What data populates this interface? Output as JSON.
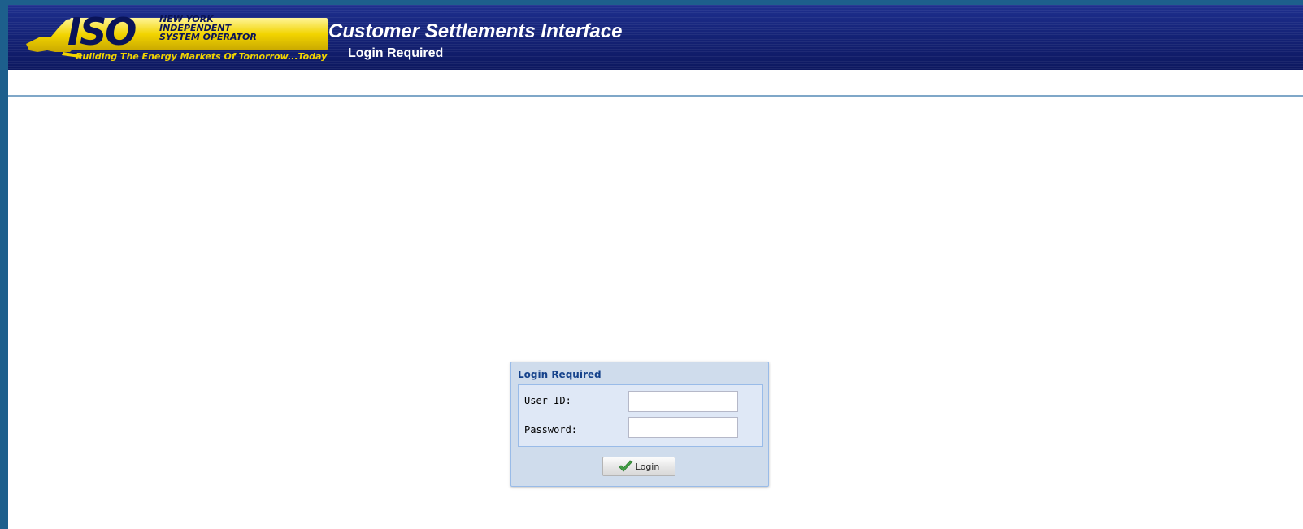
{
  "header": {
    "logo": {
      "mark": "ISO",
      "org_lines": [
        "NEW YORK",
        "INDEPENDENT",
        "SYSTEM OPERATOR"
      ],
      "tagline": "Building The Energy Markets Of Tomorrow...Today",
      "state_shape_icon": "new-york-state-icon"
    },
    "title": "Customer Settlements Interface",
    "subtitle": "Login Required"
  },
  "login_panel": {
    "title": "Login Required",
    "fields": [
      {
        "label": "User ID:",
        "value": "",
        "placeholder": ""
      },
      {
        "label": "Password:",
        "value": "",
        "placeholder": ""
      }
    ],
    "button": {
      "label": "Login",
      "icon": "check-icon"
    }
  },
  "colors": {
    "frame": "#1d5f8c",
    "header_bg": "#142275",
    "logo_gold": "#f2d400",
    "logo_navy": "#0a1458",
    "panel_bg": "#cfdcec",
    "panel_title": "#15428b",
    "divider": "#7fa7c8"
  }
}
